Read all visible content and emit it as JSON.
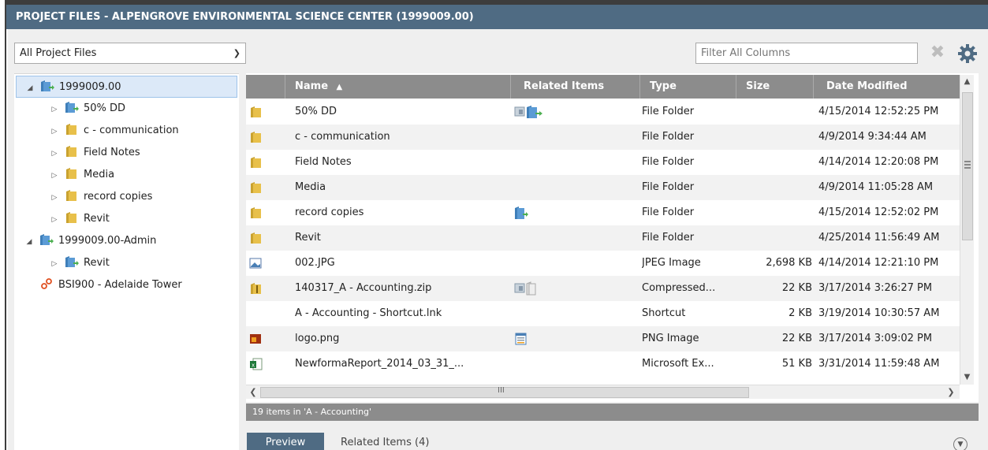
{
  "title": "PROJECT FILES - ALPENGROVE ENVIRONMENTAL SCIENCE CENTER (1999009.00)",
  "view_select": {
    "value": "All Project Files"
  },
  "filter": {
    "placeholder": "Filter All Columns"
  },
  "tree": [
    {
      "label": "1999009.00",
      "icon": "project-folder-icon",
      "toggle": "expanded"
    },
    {
      "label": "50% DD",
      "icon": "project-folder-icon",
      "toggle": "collapsed"
    },
    {
      "label": "c - communication",
      "icon": "folder-icon",
      "toggle": "collapsed"
    },
    {
      "label": "Field Notes",
      "icon": "folder-icon",
      "toggle": "collapsed"
    },
    {
      "label": "Media",
      "icon": "folder-icon",
      "toggle": "collapsed"
    },
    {
      "label": "record copies",
      "icon": "folder-icon",
      "toggle": "collapsed"
    },
    {
      "label": "Revit",
      "icon": "folder-icon",
      "toggle": "collapsed"
    },
    {
      "label": "1999009.00-Admin",
      "icon": "project-folder-icon",
      "toggle": "expanded"
    },
    {
      "label": "Revit",
      "icon": "project-folder-icon",
      "toggle": "collapsed"
    },
    {
      "label": "BSI900 - Adelaide Tower",
      "icon": "link-icon",
      "toggle": "none"
    }
  ],
  "grid": {
    "columns": [
      "Name",
      "Related Items",
      "Type",
      "Size",
      "Date Modified"
    ],
    "sort_indicator": "▲",
    "rows": [
      {
        "icon": "folder-icon",
        "name": "50% DD",
        "related": "related-items-icon",
        "type": "File Folder",
        "size": "",
        "date": "4/15/2014 12:52:25 PM"
      },
      {
        "icon": "folder-icon",
        "name": "c - communication",
        "related": "",
        "type": "File Folder",
        "size": "",
        "date": "4/9/2014 9:34:44 AM"
      },
      {
        "icon": "folder-icon",
        "name": "Field Notes",
        "related": "",
        "type": "File Folder",
        "size": "",
        "date": "4/14/2014 12:20:08 PM"
      },
      {
        "icon": "folder-icon",
        "name": "Media",
        "related": "",
        "type": "File Folder",
        "size": "",
        "date": "4/9/2014 11:05:28 AM"
      },
      {
        "icon": "folder-icon",
        "name": "record copies",
        "related": "project-folder-icon",
        "type": "File Folder",
        "size": "",
        "date": "4/15/2014 12:52:02 PM"
      },
      {
        "icon": "folder-icon",
        "name": "Revit",
        "related": "",
        "type": "File Folder",
        "size": "",
        "date": "4/25/2014 11:56:49 AM"
      },
      {
        "icon": "image-file-icon",
        "name": "002.JPG",
        "related": "",
        "type": "JPEG Image",
        "size": "2,698 KB",
        "date": "4/14/2014 12:21:10 PM"
      },
      {
        "icon": "zip-file-icon",
        "name": "140317_A - Accounting.zip",
        "related": "transmittal-icon",
        "type": "Compressed...",
        "size": "22 KB",
        "date": "3/17/2014 3:26:27 PM"
      },
      {
        "icon": "",
        "name": "A - Accounting - Shortcut.lnk",
        "related": "",
        "type": "Shortcut",
        "size": "2 KB",
        "date": "3/19/2014 10:30:57 AM"
      },
      {
        "icon": "png-file-icon",
        "name": "logo.png",
        "related": "list-icon",
        "type": "PNG Image",
        "size": "22 KB",
        "date": "3/17/2014 3:09:02 PM"
      },
      {
        "icon": "excel-file-icon",
        "name": "NewformaReport_2014_03_31_...",
        "related": "",
        "type": "Microsoft Ex...",
        "size": "51 KB",
        "date": "3/31/2014 11:59:48 AM"
      }
    ]
  },
  "scrollbar": {
    "h_grip": "III"
  },
  "status_text": "19 items in 'A - Accounting'",
  "tabs": {
    "preview": "Preview",
    "related": "Related Items (4)"
  },
  "colors": {
    "title_bar": "#4f6b83",
    "header": "#8c8c8c",
    "folder": "#e8c04a",
    "project_folder": "#5b9bd5",
    "link": "#e05020"
  }
}
